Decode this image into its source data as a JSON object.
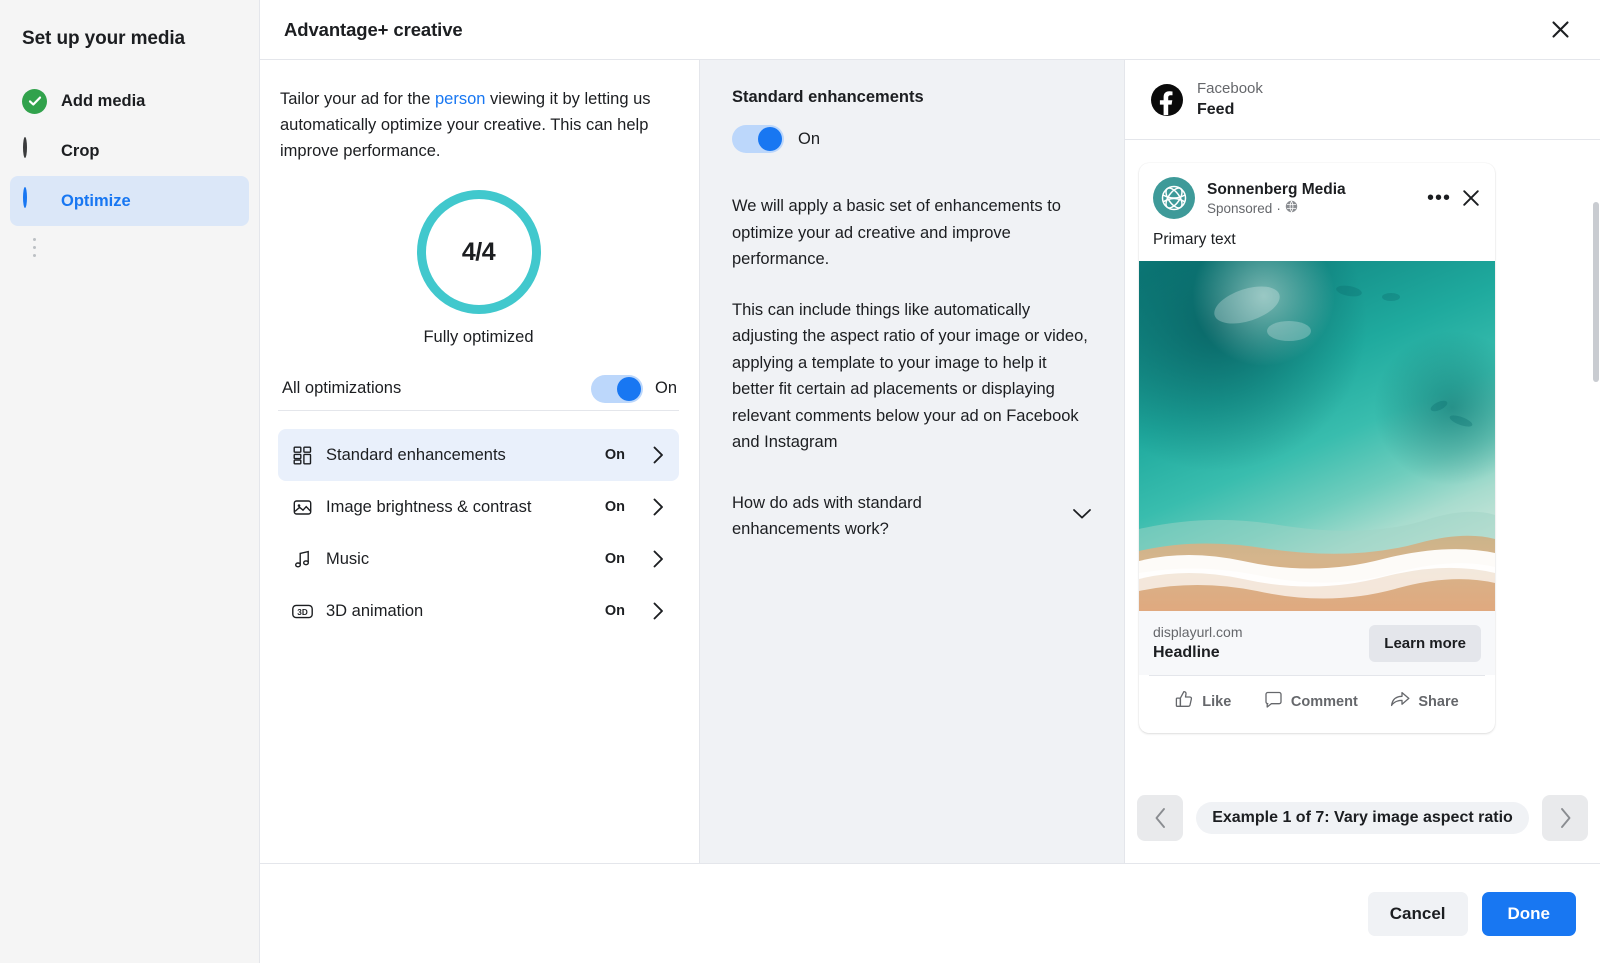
{
  "sidebar": {
    "title": "Set up your media",
    "items": [
      {
        "label": "Add media",
        "icon": "check-circle-icon",
        "state": "complete"
      },
      {
        "label": "Crop",
        "icon": "circle-outline-icon",
        "state": "pending"
      },
      {
        "label": "Optimize",
        "icon": "half-circle-icon",
        "state": "active"
      }
    ]
  },
  "header": {
    "title": "Advantage+ creative",
    "close_icon": "close-icon"
  },
  "optimize": {
    "intro_before": "Tailor your ad for the ",
    "intro_link": "person",
    "intro_after": " viewing it by letting us automatically optimize your creative. This can help improve performance.",
    "score": "4/4",
    "score_caption": "Fully optimized",
    "all_optimizations_label": "All optimizations",
    "all_optimizations_state": "On",
    "items": [
      {
        "label": "Standard enhancements",
        "state": "On",
        "icon": "grid-blocks-icon",
        "selected": true
      },
      {
        "label": "Image brightness & contrast",
        "state": "On",
        "icon": "image-icon",
        "selected": false
      },
      {
        "label": "Music",
        "state": "On",
        "icon": "music-note-icon",
        "selected": false
      },
      {
        "label": "3D animation",
        "state": "On",
        "icon": "3d-icon",
        "selected": false
      }
    ]
  },
  "detail": {
    "title": "Standard enhancements",
    "toggle_state": "On",
    "paragraph_1": "We will apply a basic set of enhancements to optimize your ad creative and improve performance.",
    "paragraph_2": "This can include things like automatically adjusting the aspect ratio of your image or video, applying a template to your image to help it better fit certain ad placements or displaying relevant comments below your ad on Facebook and Instagram",
    "accordion_label": "How do ads with standard enhancements work?",
    "accordion_icon": "chevron-down-icon"
  },
  "preview": {
    "platform": "Facebook",
    "placement": "Feed",
    "platform_icon": "facebook-logo-icon",
    "ad": {
      "brand": "Sonnenberg Media",
      "sponsored": "Sponsored",
      "audience_icon": "globe-icon",
      "menu_icon": "more-options-icon",
      "close_icon": "close-icon",
      "primary_text": "Primary text",
      "display_url": "displayurl.com",
      "headline": "Headline",
      "cta_label": "Learn more",
      "actions": [
        {
          "label": "Like",
          "icon": "thumbs-up-icon"
        },
        {
          "label": "Comment",
          "icon": "comment-bubble-icon"
        },
        {
          "label": "Share",
          "icon": "share-arrow-icon"
        }
      ]
    },
    "carousel": {
      "prev_icon": "chevron-left-icon",
      "next_icon": "chevron-right-icon",
      "label": "Example 1 of 7: Vary image aspect ratio"
    }
  },
  "footer": {
    "cancel_label": "Cancel",
    "done_label": "Done"
  },
  "colors": {
    "accent_blue": "#1877f2",
    "ring_teal": "#41c8cd",
    "complete_green": "#31a24c",
    "brand_teal": "#3e9a99"
  }
}
